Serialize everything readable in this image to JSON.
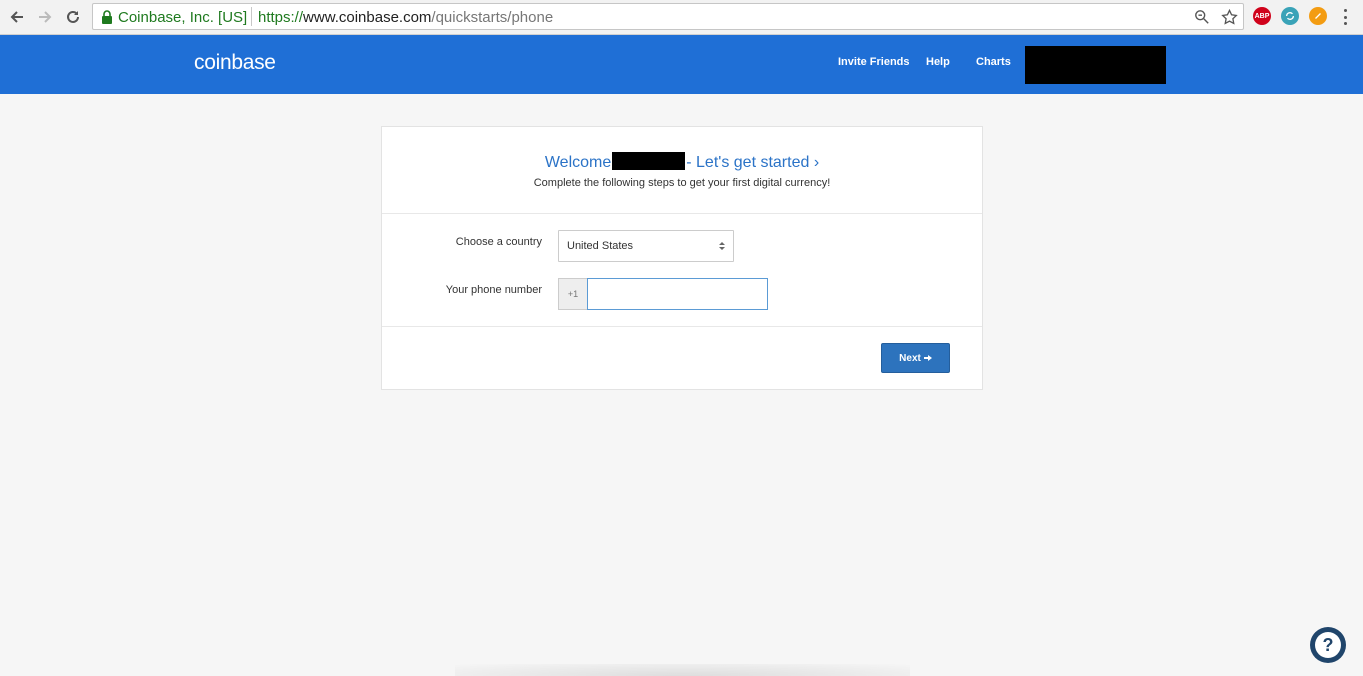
{
  "browser": {
    "site_identity": "Coinbase, Inc. [US]",
    "url_scheme": "https://",
    "url_host": "www.coinbase.com",
    "url_path": "/quickstarts/phone",
    "extensions": [
      {
        "name": "adblock-plus-icon",
        "label": "ABP",
        "color": "#d0021b"
      },
      {
        "name": "sync-extension-icon",
        "label": "",
        "color": "#3aa3b8"
      },
      {
        "name": "orange-extension-icon",
        "label": "",
        "color": "#f39c12"
      }
    ]
  },
  "header": {
    "logo": "coinbase",
    "nav": [
      "Invite Friends",
      "Help",
      "Charts"
    ],
    "brand_color": "#1f6fd6"
  },
  "card": {
    "welcome_prefix": "Welcome",
    "welcome_suffix": "- Let's get started ›",
    "subtitle": "Complete the following steps to get your first digital currency!",
    "country_label": "Choose a country",
    "country_value": "United States",
    "phone_label": "Your phone number",
    "phone_prefix": "+1",
    "phone_value": "",
    "next_label": "Next"
  },
  "help_widget": {
    "symbol": "?"
  }
}
